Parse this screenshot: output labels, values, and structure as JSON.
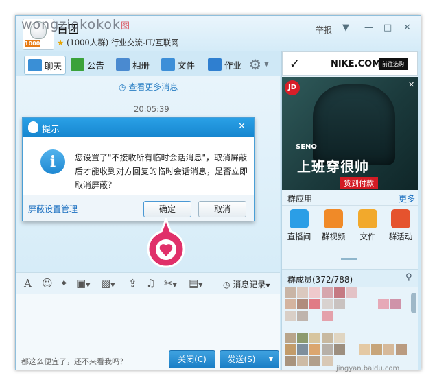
{
  "watermark": {
    "text": "wongziokokok",
    "mark": "图"
  },
  "group": {
    "name": "百团",
    "subtitle": "(1000人群) 行业交流-IT/互联网",
    "avatar_badge": "1000"
  },
  "titlebar": {
    "report_label": "举报",
    "minimize": "—",
    "maximize": "□",
    "close": "✕"
  },
  "tabs": [
    {
      "label": "聊天",
      "icon": "chat-icon",
      "color": "#3a8fd6"
    },
    {
      "label": "公告",
      "icon": "megaphone-icon",
      "color": "#3aa23a"
    },
    {
      "label": "相册",
      "icon": "photo-icon",
      "color": "#4a8ad0"
    },
    {
      "label": "文件",
      "icon": "folder-icon",
      "color": "#3d8fd8"
    },
    {
      "label": "作业",
      "icon": "homework-icon",
      "color": "#2f7fd0"
    }
  ],
  "chat": {
    "view_more": "查看更多消息",
    "timestamp": "20:05:39"
  },
  "dialog": {
    "title": "提示",
    "message": "您设置了\"不接收所有临时会话消息\"，取消屏蔽后才能收到对方回复的临时会话消息，是否立即取消屏蔽？",
    "link": "屏蔽设置管理",
    "ok": "确定",
    "cancel": "取消",
    "close": "✕"
  },
  "toolbar": {
    "history_label": "消息记录"
  },
  "input": {
    "placeholder": "都这么便宜了，还不来看我吗？"
  },
  "buttons": {
    "close_label": "关闭(C)",
    "send_label": "发送(S)"
  },
  "ads": {
    "nike": {
      "brand": "NIKE.COM",
      "cta": "前往选购"
    },
    "jd": {
      "logo": "JD",
      "brand": "SENO",
      "slogan": "上班穿很帅",
      "cta": "货到付款"
    }
  },
  "apps": {
    "title": "群应用",
    "more": "更多",
    "items": [
      {
        "label": "直播间",
        "icon": "live-room-icon",
        "color": "#2b9ee6"
      },
      {
        "label": "群视频",
        "icon": "group-video-icon",
        "color": "#f08a28"
      },
      {
        "label": "文件",
        "icon": "file-icon",
        "color": "#f2a92c"
      },
      {
        "label": "群活动",
        "icon": "group-activity-icon",
        "color": "#e5532e"
      }
    ]
  },
  "members": {
    "title": "群成员(372/788)"
  },
  "page_watermark": "jingyan.baidu.com",
  "colors": {
    "accent": "#1686cf",
    "pin": "#e0306a",
    "window_bg": "#cfe8f6"
  }
}
